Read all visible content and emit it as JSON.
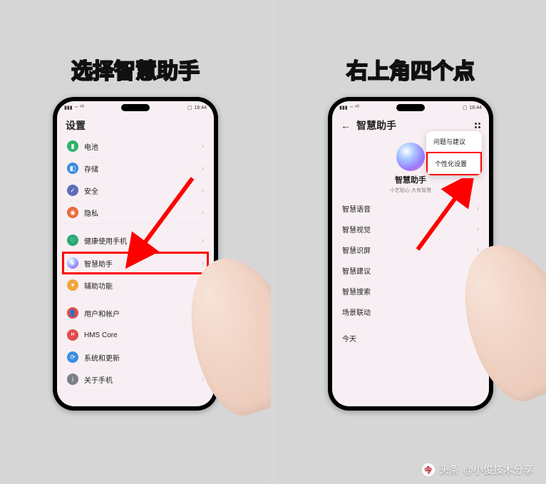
{
  "captions": {
    "left": "选择智慧助手",
    "right": "右上角四个点"
  },
  "status": {
    "carrier_icons": "◦◦  ⁴ᴳ",
    "time": "16:44",
    "battery": "▢"
  },
  "left_phone": {
    "title": "设置",
    "items": [
      {
        "label": "电池",
        "icon_bg": "#2fb36a",
        "glyph": "▮"
      },
      {
        "label": "存储",
        "icon_bg": "#3a8de0",
        "glyph": "◧"
      },
      {
        "label": "安全",
        "icon_bg": "#5f6db8",
        "glyph": "✓"
      },
      {
        "label": "隐私",
        "icon_bg": "#e96a3b",
        "glyph": "◉"
      },
      {
        "label": "健康使用手机",
        "icon_bg": "#2aa875",
        "glyph": "♡"
      },
      {
        "label": "智慧助手",
        "icon_bg": "grad",
        "glyph": "●"
      },
      {
        "label": "辅助功能",
        "icon_bg": "#f0a63a",
        "glyph": "✦"
      },
      {
        "label": "用户和帐户",
        "icon_bg": "#e34b4b",
        "glyph": "👤"
      },
      {
        "label": "HMS Core",
        "icon_bg": "#e34b4b",
        "glyph": "H"
      },
      {
        "label": "系统和更新",
        "icon_bg": "#3a8de0",
        "glyph": "⟳"
      },
      {
        "label": "关于手机",
        "icon_bg": "#7a7f88",
        "glyph": "i"
      }
    ]
  },
  "right_phone": {
    "title": "智慧助手",
    "hero_title": "智慧助手",
    "hero_sub": "小艺贴心·大有智慧",
    "popup": {
      "item1": "问题与建议",
      "item2": "个性化设置"
    },
    "rows": [
      "智慧语音",
      "智慧视觉",
      "智慧识屏",
      "智慧建议",
      "智慧搜索",
      "场景联动",
      "今天"
    ]
  },
  "watermark": {
    "prefix": "头条",
    "handle": "@小俊技术分享"
  }
}
